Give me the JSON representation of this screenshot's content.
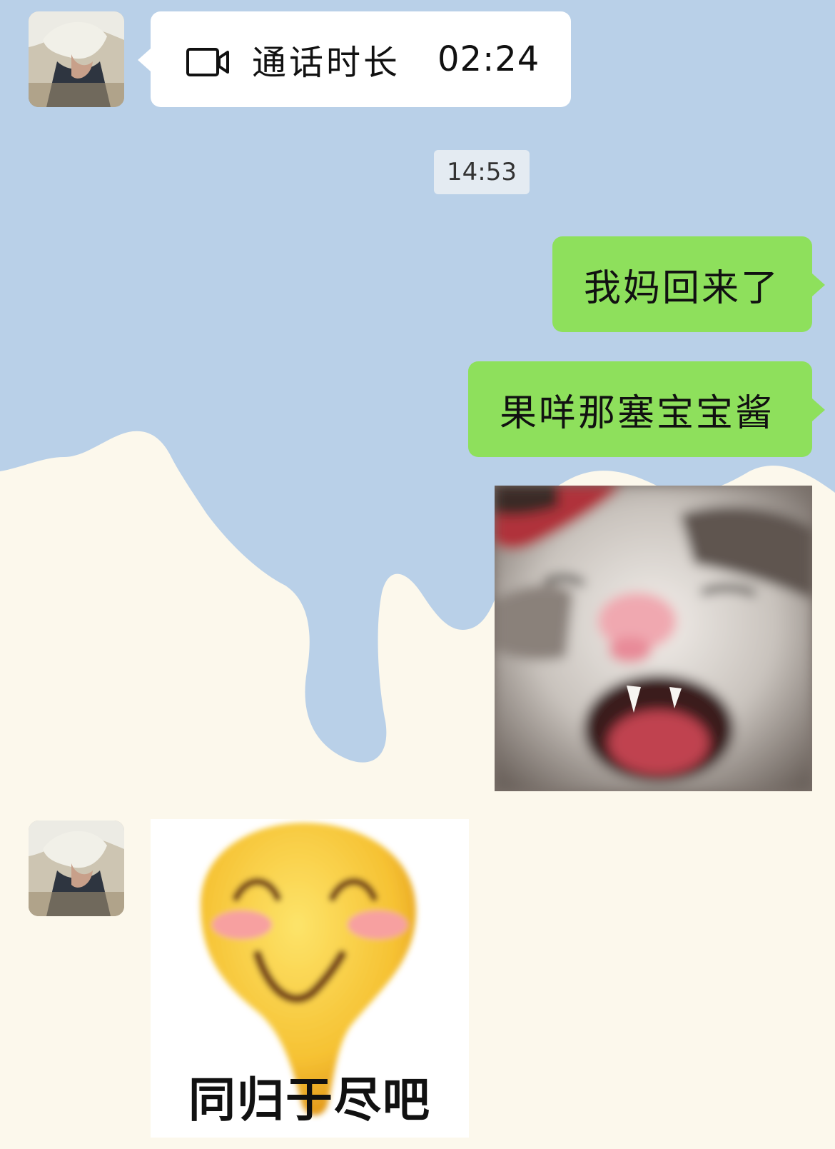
{
  "chat": {
    "call_record": {
      "icon": "video-camera-icon",
      "label": "通话时长",
      "duration": "02:24"
    },
    "timestamp": "14:53",
    "outgoing_messages": [
      {
        "text": "我妈回来了"
      },
      {
        "text": "果咩那塞宝宝酱"
      }
    ],
    "outgoing_image": {
      "description": "screaming-cat-photo"
    },
    "incoming_sticker": {
      "caption": "同归于尽吧"
    }
  },
  "colors": {
    "wallpaper_blue": "#b9d0e8",
    "wallpaper_cream": "#fcf8ec",
    "bubble_incoming": "#ffffff",
    "bubble_outgoing": "#8ee05c",
    "timestamp_bg": "#e4ebf2"
  }
}
